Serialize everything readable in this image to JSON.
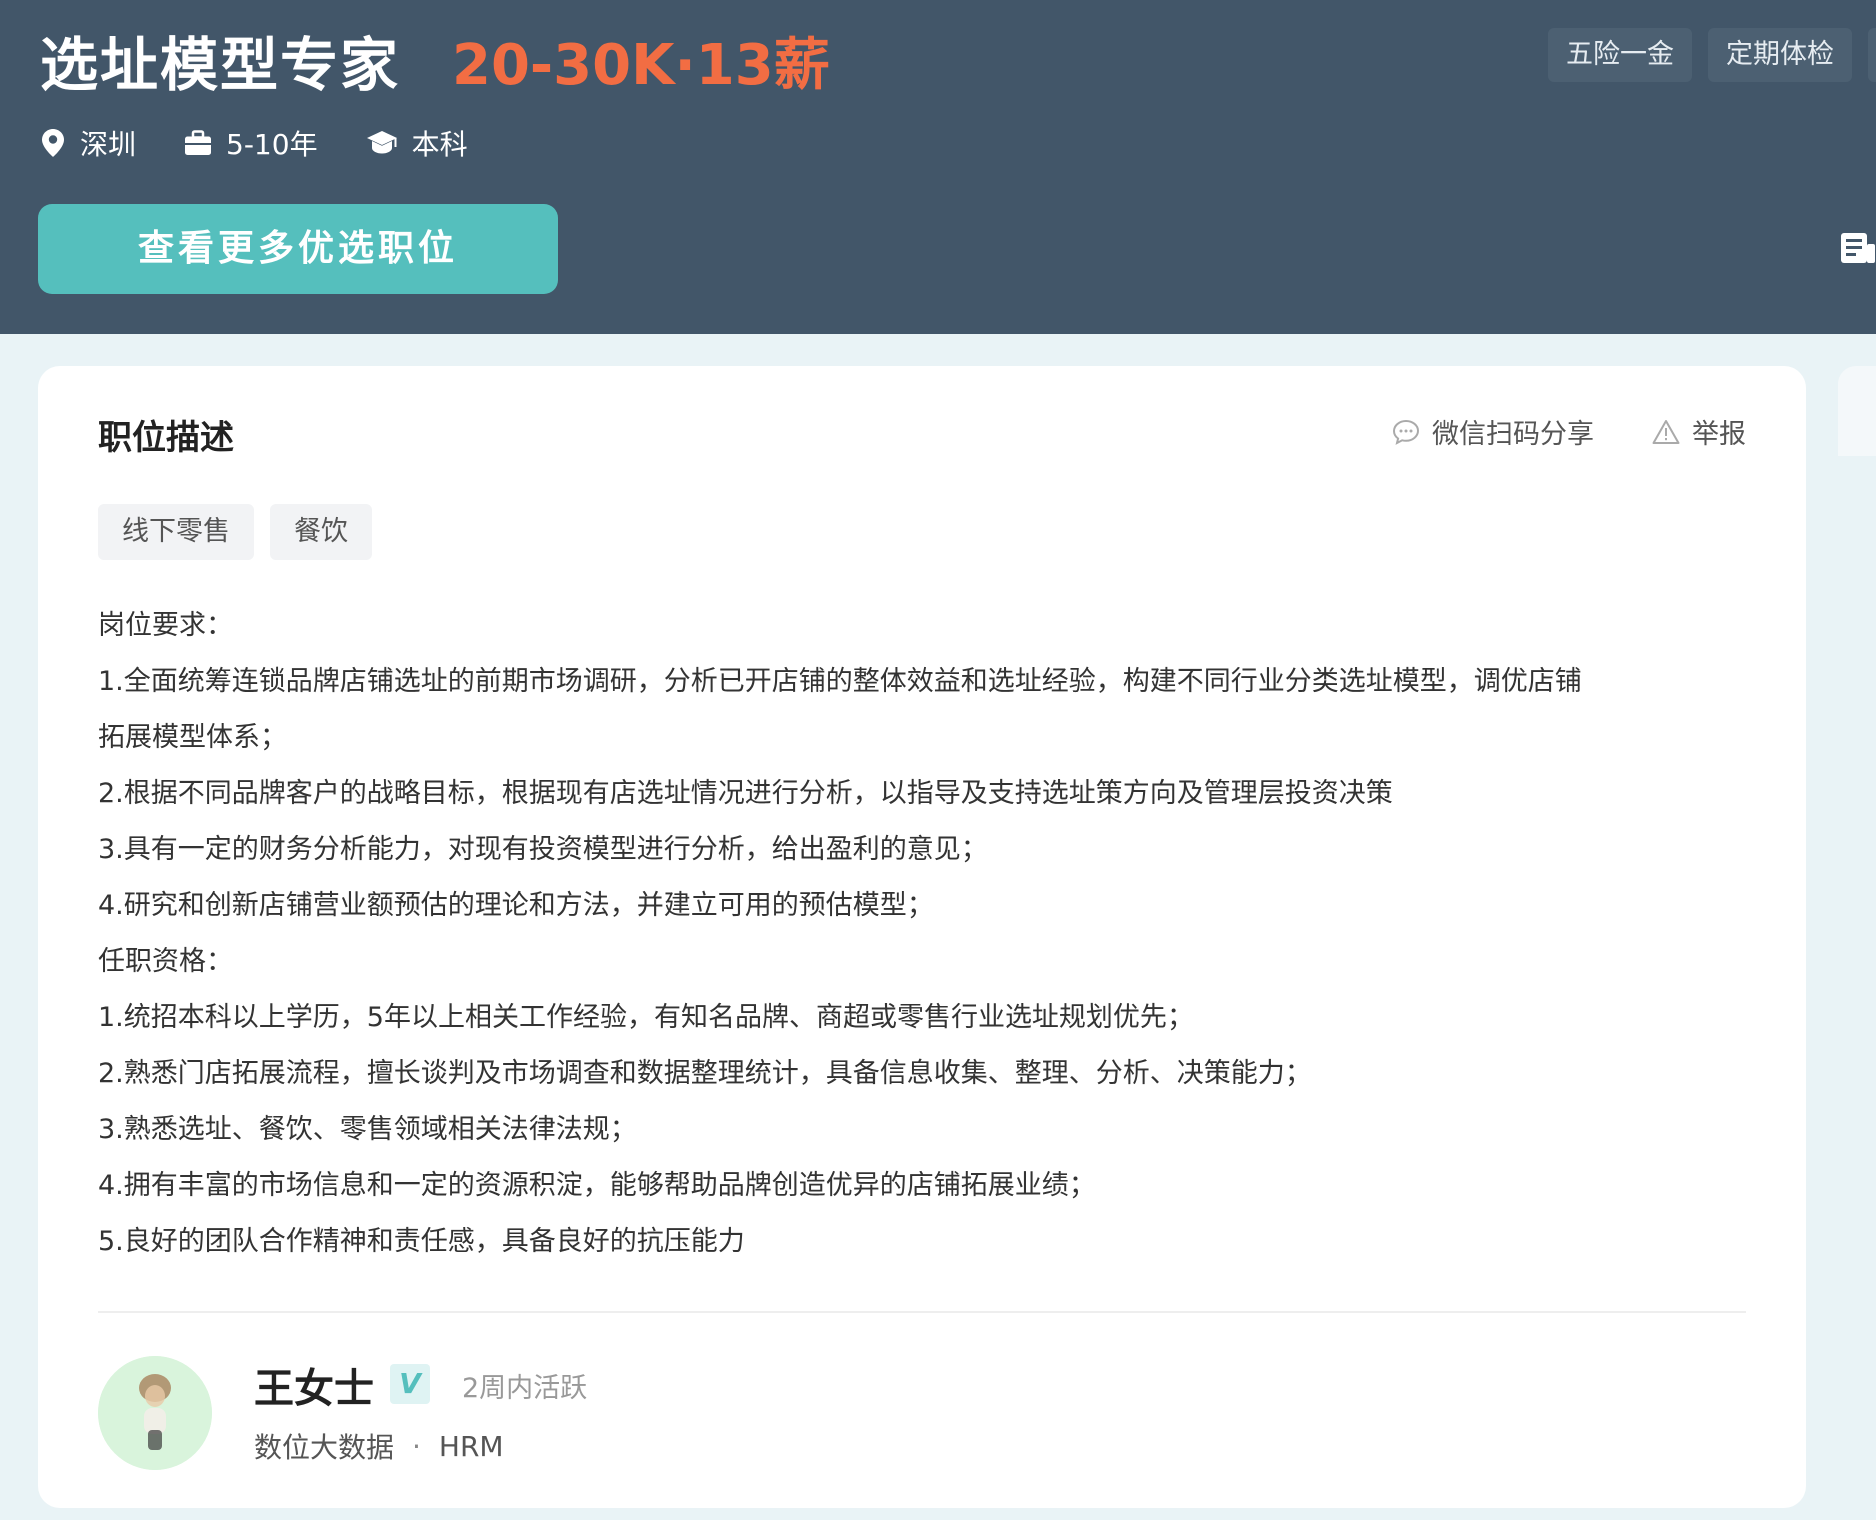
{
  "header": {
    "title": "选址模型专家",
    "salary": "20-30K·13薪",
    "benefits": [
      "五险一金",
      "定期体检"
    ],
    "meta": {
      "location": "深圳",
      "experience": "5-10年",
      "education": "本科"
    },
    "more_jobs_button": "查看更多优选职位"
  },
  "card": {
    "section_title": "职位描述",
    "actions": {
      "share": "微信扫码分享",
      "report": "举报"
    },
    "tags": [
      "线下零售",
      "餐饮"
    ],
    "description_lines": [
      "岗位要求：",
      "1.全面统筹连锁品牌店铺选址的前期市场调研，分析已开店铺的整体效益和选址经验，构建不同行业分类选址模型，调优店铺",
      "拓展模型体系；",
      "2.根据不同品牌客户的战略目标，根据现有店选址情况进行分析，以指导及支持选址策方向及管理层投资决策",
      "3.具有一定的财务分析能力，对现有投资模型进行分析，给出盈利的意见；",
      "4.研究和创新店铺营业额预估的理论和方法，并建立可用的预估模型；",
      "任职资格：",
      "1.统招本科以上学历，5年以上相关工作经验，有知名品牌、商超或零售行业选址规划优先；",
      "2.熟悉门店拓展流程，擅长谈判及市场调查和数据整理统计，具备信息收集、整理、分析、决策能力；",
      "3.熟悉选址、餐饮、零售领域相关法律法规；",
      "4.拥有丰富的市场信息和一定的资源积淀，能够帮助品牌创造优异的店铺拓展业绩；",
      "5.良好的团队合作精神和责任感，具备良好的抗压能力"
    ],
    "recruiter": {
      "name": "王女士",
      "verified_mark": "V",
      "active": "2周内活跃",
      "company": "数位大数据",
      "separator": "·",
      "role": "HRM"
    }
  },
  "colors": {
    "header_bg": "#425669",
    "salary": "#f26d43",
    "accent_teal": "#55bfbd",
    "page_bg": "#e9f3f6"
  },
  "icons": [
    "location-pin-icon",
    "briefcase-icon",
    "graduation-cap-icon",
    "chat-bubble-icon",
    "warning-icon",
    "document-icon"
  ]
}
